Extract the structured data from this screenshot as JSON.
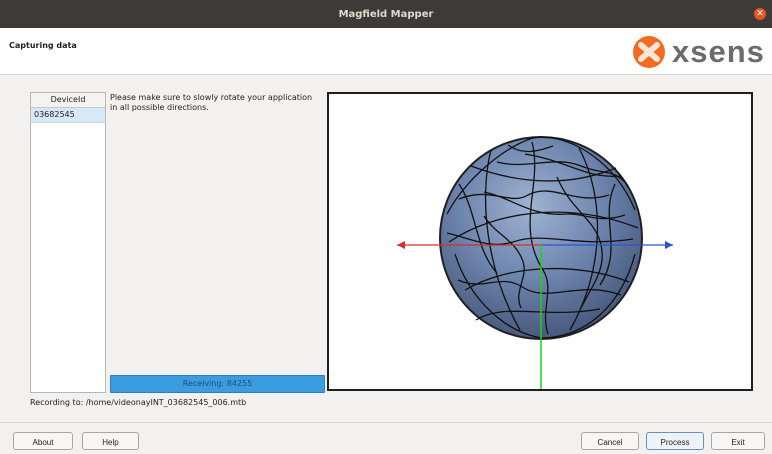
{
  "window": {
    "title": "Magfield Mapper"
  },
  "header": {
    "page_title": "Capturing data",
    "brand": "xsens"
  },
  "devices": {
    "column_header": "DeviceId",
    "items": [
      "03682545"
    ]
  },
  "instructions": "Please make sure to slowly rotate your application in all possible directions.",
  "progress": {
    "label": "Receiving: 84255"
  },
  "recording": "Recording to: /home/videonayINT_03682545_006.mtb",
  "buttons": {
    "about": "About",
    "help": "Help",
    "cancel": "Cancel",
    "process": "Process",
    "exit": "Exit"
  },
  "colors": {
    "accent": "#3c9ce0",
    "titlebar": "#3c3b37",
    "close": "#e95420",
    "logo_orange": "#f26b21"
  }
}
